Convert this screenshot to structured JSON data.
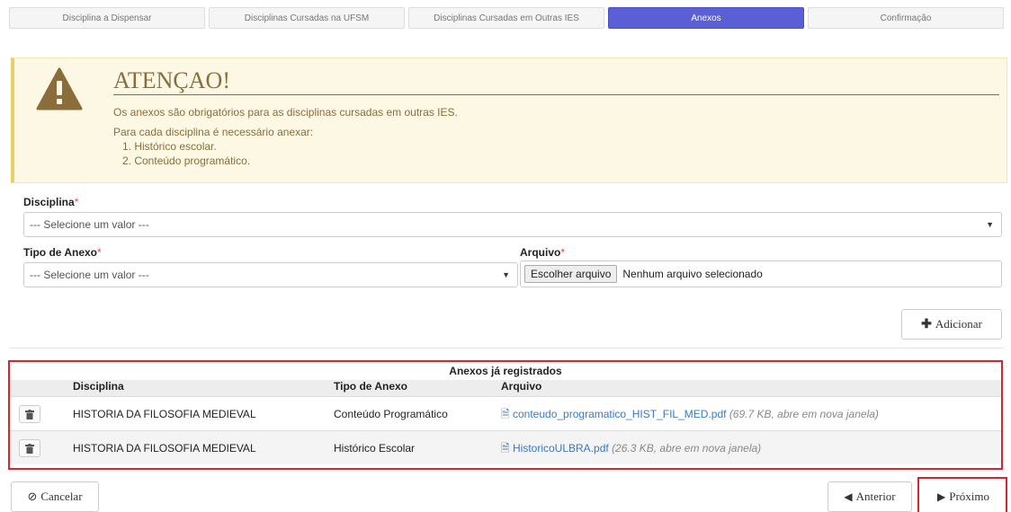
{
  "wizard": {
    "steps": [
      {
        "label": "Disciplina a Dispensar"
      },
      {
        "label": "Disciplinas Cursadas na UFSM"
      },
      {
        "label": "Disciplinas Cursadas em Outras IES"
      },
      {
        "label": "Anexos"
      },
      {
        "label": "Confirmação"
      }
    ],
    "active_index": 3,
    "active_color": "#5b5fd6"
  },
  "alert": {
    "title": "ATENÇAO!",
    "message": "Os anexos são obrigatórios para as disciplinas cursadas em outras IES.",
    "intro": "Para cada disciplina é necessário anexar:",
    "items": [
      "1. Histórico escolar.",
      "2. Conteúdo programático."
    ],
    "icon": "warning-icon",
    "color": "#8a6d3b",
    "background": "#fcf8e3"
  },
  "form": {
    "disciplina_label": "Disciplina",
    "disciplina_value": "--- Selecione um valor ---",
    "tipo_label": "Tipo de Anexo",
    "tipo_value": "--- Selecione um valor ---",
    "arquivo_label": "Arquivo",
    "file_button": "Escolher arquivo",
    "file_status": "Nenhum arquivo selecionado",
    "required_mark": "*",
    "add_button": "Adicionar",
    "add_icon": "plus-icon"
  },
  "annexes": {
    "title": "Anexos já registrados",
    "columns": [
      "Disciplina",
      "Tipo de Anexo",
      "Arquivo"
    ],
    "rows": [
      {
        "disciplina": "HISTORIA DA FILOSOFIA MEDIEVAL",
        "tipo": "Conteúdo Programático",
        "arquivo": "conteudo_programatico_HIST_FIL_MED.pdf",
        "meta": "(69.7 KB, abre em nova janela)"
      },
      {
        "disciplina": "HISTORIA DA FILOSOFIA MEDIEVAL",
        "tipo": "Histórico Escolar",
        "arquivo": "HistoricoULBRA.pdf",
        "meta": "(26.3 KB, abre em nova janela)"
      }
    ],
    "highlight_color": "#d6262f"
  },
  "footer": {
    "cancel": "Cancelar",
    "previous": "Anterior",
    "next": "Próximo"
  }
}
